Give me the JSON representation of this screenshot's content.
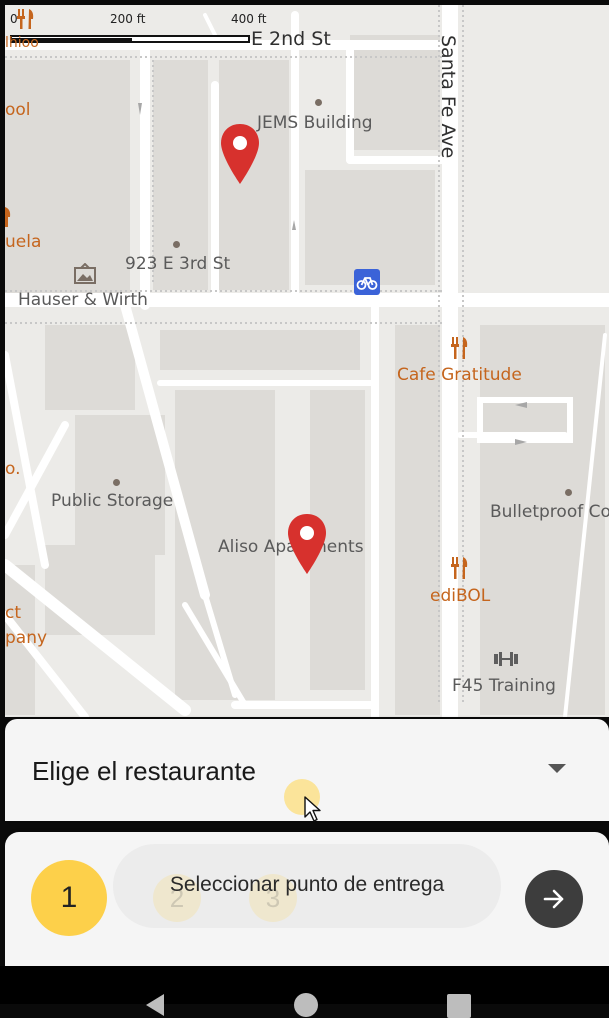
{
  "map": {
    "scale": {
      "zero": "0",
      "mid": "200 ft",
      "end": "400 ft"
    },
    "streets": [
      {
        "name": "E 2nd St"
      },
      {
        "name": "Santa Fe Ave"
      }
    ],
    "places": {
      "jems": "JEMS Building",
      "addr": "923 E 3rd St",
      "hauser": "Hauser & Wirth",
      "cafe": "Cafe Gratitude",
      "storage": "Public Storage",
      "bulletproof": "Bulletproof Co",
      "aliso": "Aliso Apartments",
      "edibol": "ediBOL",
      "f45": "F45 Training",
      "partial": {
        "school": "ool",
        "escuela": "uela",
        "topleft": "lhioo",
        "midleft": "o.",
        "act": "ct",
        "company": "pany"
      }
    },
    "markers": [
      {
        "name": "delivery-marker-1",
        "color": "#d7312d"
      },
      {
        "name": "delivery-marker-2",
        "color": "#d7312d"
      }
    ]
  },
  "select": {
    "label": "Elige el restaurante"
  },
  "steps": {
    "current": "1",
    "ghost": [
      "2",
      "3"
    ],
    "instruction": "Seleccionar punto de entrega",
    "next_icon": "arrow-right-icon"
  },
  "colors": {
    "accent": "#fdd04a",
    "marker": "#d7312d",
    "poi_orange": "#c5651d",
    "dark_button": "#3d3d3d"
  }
}
